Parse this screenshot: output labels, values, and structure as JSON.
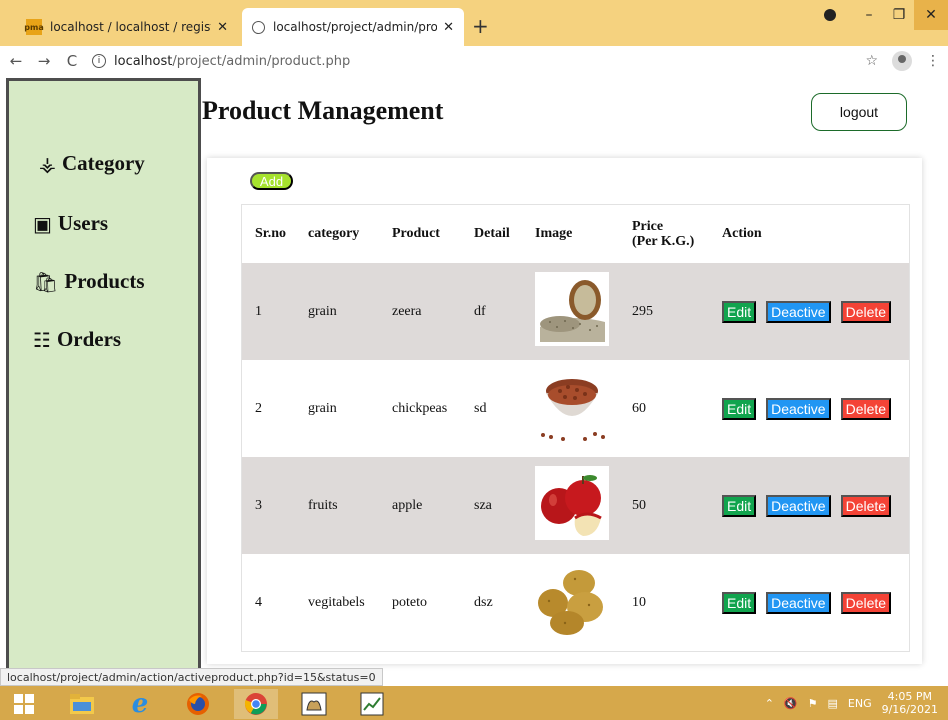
{
  "browser": {
    "tabs": [
      {
        "title": "localhost / localhost / register / s",
        "favicon": "phpmyadmin-icon"
      },
      {
        "title": "localhost/project/admin/product",
        "favicon": "globe-icon"
      }
    ],
    "new_tab": "+",
    "address": {
      "host": "localhost",
      "path": "/project/admin/product.php"
    },
    "status_url": "localhost/project/admin/action/activeproduct.php?id=15&status=0"
  },
  "sidebar": {
    "items": [
      {
        "label": "Category",
        "icon": "category-icon"
      },
      {
        "label": "Users",
        "icon": "users-icon"
      },
      {
        "label": "Products",
        "icon": "products-icon"
      },
      {
        "label": "Orders",
        "icon": "orders-icon"
      }
    ]
  },
  "header": {
    "title": "Product Management",
    "logout": "logout"
  },
  "table": {
    "add_label": "Add",
    "columns": {
      "sr": "Sr.no",
      "category": "category",
      "product": "Product",
      "detail": "Detail",
      "image": "Image",
      "price_1": "Price",
      "price_2": "(Per K.G.)",
      "action": "Action"
    },
    "actions": {
      "edit": "Edit",
      "deactive": "Deactive",
      "delete": "Delete"
    },
    "rows": [
      {
        "sr": "1",
        "category": "grain",
        "product": "zeera",
        "detail": "df",
        "price": "295",
        "image": "cumin-seeds"
      },
      {
        "sr": "2",
        "category": "grain",
        "product": "chickpeas",
        "detail": "sd",
        "price": "60",
        "image": "chickpeas-bowl"
      },
      {
        "sr": "3",
        "category": "fruits",
        "product": "apple",
        "detail": "sza",
        "price": "50",
        "image": "red-apples"
      },
      {
        "sr": "4",
        "category": "vegitabels",
        "product": "poteto",
        "detail": "dsz",
        "price": "10",
        "image": "potatoes"
      }
    ]
  },
  "taskbar": {
    "lang": "ENG",
    "time": "4:05 PM",
    "date": "9/16/2021"
  },
  "colors": {
    "sidebar_bg": "#d7eac6",
    "add": "#a6e22e",
    "edit": "#11a44e",
    "deactive": "#2196f3",
    "delete": "#f44336",
    "row_shade": "#dedad9",
    "tabstrip": "#f5d27f",
    "taskbar": "#d6a84b"
  }
}
